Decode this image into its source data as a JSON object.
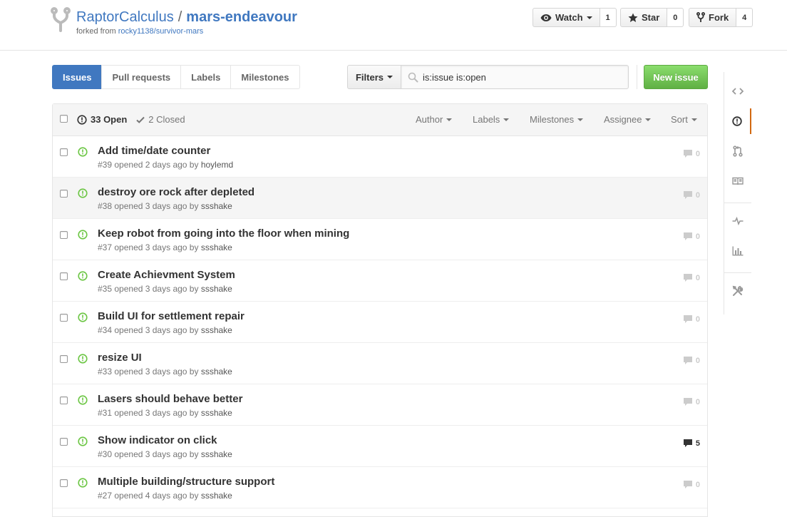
{
  "header": {
    "owner": "RaptorCalculus",
    "separator": "/",
    "repo_name": "mars-endeavour",
    "forked_from_prefix": "forked from",
    "forked_from_repo": "rocky1138/survivor-mars",
    "icon": "repo-forked-icon"
  },
  "actions": {
    "watch_label": "Watch",
    "watch_count": "1",
    "star_label": "Star",
    "star_count": "0",
    "fork_label": "Fork",
    "fork_count": "4"
  },
  "subnav": {
    "tabs": [
      {
        "label": "Issues",
        "selected": true
      },
      {
        "label": "Pull requests",
        "selected": false
      },
      {
        "label": "Labels",
        "selected": false
      },
      {
        "label": "Milestones",
        "selected": false
      }
    ],
    "filters_label": "Filters",
    "search_value": "is:issue is:open",
    "new_issue_label": "New issue"
  },
  "table_header": {
    "open_label": "33 Open",
    "closed_label": "2 Closed",
    "filters": [
      "Author",
      "Labels",
      "Milestones",
      "Assignee",
      "Sort"
    ]
  },
  "issues": [
    {
      "title": "Add time/date counter",
      "number": "#39",
      "opened": "opened 2 days ago by",
      "author": "hoylemd",
      "comments": "0"
    },
    {
      "title": "destroy ore rock after depleted",
      "number": "#38",
      "opened": "opened 3 days ago by",
      "author": "ssshake",
      "comments": "0"
    },
    {
      "title": "Keep robot from going into the floor when mining",
      "number": "#37",
      "opened": "opened 3 days ago by",
      "author": "ssshake",
      "comments": "0"
    },
    {
      "title": "Create Achievment System",
      "number": "#35",
      "opened": "opened 3 days ago by",
      "author": "ssshake",
      "comments": "0"
    },
    {
      "title": "Build UI for settlement repair",
      "number": "#34",
      "opened": "opened 3 days ago by",
      "author": "ssshake",
      "comments": "0"
    },
    {
      "title": "resize UI",
      "number": "#33",
      "opened": "opened 3 days ago by",
      "author": "ssshake",
      "comments": "0"
    },
    {
      "title": "Lasers should behave better",
      "number": "#31",
      "opened": "opened 3 days ago by",
      "author": "ssshake",
      "comments": "0"
    },
    {
      "title": "Show indicator on click",
      "number": "#30",
      "opened": "opened 3 days ago by",
      "author": "ssshake",
      "comments": "5"
    },
    {
      "title": "Multiple building/structure support",
      "number": "#27",
      "opened": "opened 4 days ago by",
      "author": "ssshake",
      "comments": "0"
    }
  ],
  "repo_nav": {
    "items": [
      "code-icon",
      "issue-opened-icon",
      "git-pull-request-icon",
      "book-icon",
      "pulse-icon",
      "graph-icon",
      "tools-icon"
    ]
  },
  "colors": {
    "link": "#4078c0",
    "open_green": "#6cc644",
    "new_issue_green": "#60b044",
    "selected_tab": "#4078c0",
    "nav_accent": "#d26911"
  }
}
